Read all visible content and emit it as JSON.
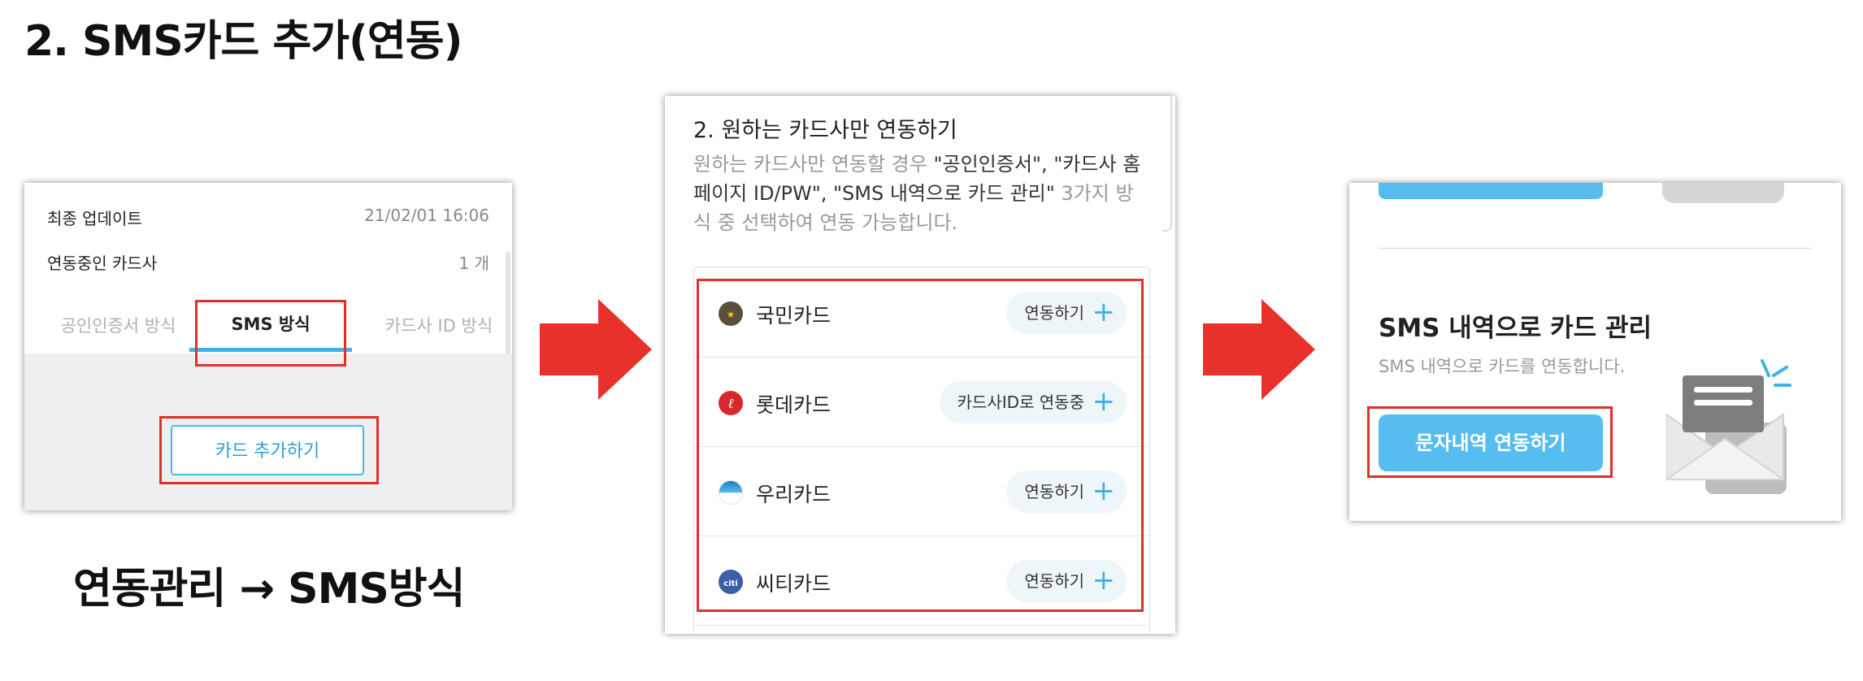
{
  "page_title": "2. SMS카드 추가(연동)",
  "caption": "연동관리 → SMS방식",
  "colors": {
    "highlight": "#e0302a",
    "accent": "#3fb1e6",
    "button": "#57bdf0",
    "arrow": "#e8312a"
  },
  "panel1": {
    "last_update_label": "최종 업데이트",
    "last_update_value": "21/02/01 16:06",
    "linked_cards_label": "연동중인 카드사",
    "linked_cards_value": "1 개",
    "tabs": [
      "공인인증서 방식",
      "SMS 방식",
      "카드사 ID 방식"
    ],
    "selected_tab": "SMS 방식",
    "add_card_button": "카드 추가하기"
  },
  "panel2": {
    "heading": "2. 원하는 카드사만 연동하기",
    "desc_1": "원하는 카드사만 연동할 경우 ",
    "desc_2": "\"공인인증서\", \"카드사 홈페이지 ID/PW\", \"SMS 내역으로 카드 관리\"",
    "desc_3": " 3가지 방식 중 선택하여 연동 가능합니다.",
    "cards": [
      {
        "name": "국민카드",
        "action": "연동하기",
        "icon": "kb-card-logo-icon",
        "color": "#5a4f3c"
      },
      {
        "name": "롯데카드",
        "action": "카드사ID로 연동중",
        "icon": "lotte-card-logo-icon",
        "color": "#d9272e"
      },
      {
        "name": "우리카드",
        "action": "연동하기",
        "icon": "woori-card-logo-icon",
        "color": "#1d7ec2"
      },
      {
        "name": "씨티카드",
        "action": "연동하기",
        "icon": "citi-card-logo-icon",
        "color": "#3b5ea8"
      }
    ],
    "plus_glyph": "+"
  },
  "panel3": {
    "heading": "SMS 내역으로 카드 관리",
    "subtext": "SMS 내역으로 카드를 연동합니다.",
    "button": "문자내역 연동하기",
    "icon": "envelope-message-icon"
  }
}
